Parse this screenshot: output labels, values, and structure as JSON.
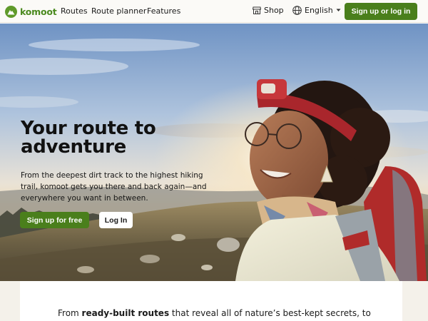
{
  "header": {
    "logo_text": "komoot",
    "nav": {
      "routes": "Routes",
      "route_planner": "Route planner",
      "features": "Features"
    },
    "shop_label": "Shop",
    "language_label": "English",
    "signup_login_label": "Sign up or log in"
  },
  "hero": {
    "title_line1": "Your route to",
    "title_line2": "adventure",
    "subtitle": "From the deepest dirt track to the highest hiking trail, komoot gets you there and back again—and everywhere you want in between.",
    "primary_cta": "Sign up for free",
    "secondary_cta": "Log In"
  },
  "intro": {
    "prefix": "From ",
    "bold": "ready-built routes",
    "suffix": " that reveal all of nature’s best-kept secrets, to"
  },
  "icons": {
    "logo": "komoot-logo-icon",
    "shop": "shop-icon",
    "language": "globe-icon",
    "chevron": "chevron-down-icon"
  },
  "colors": {
    "brand_green": "#4a7f1c",
    "logo_green": "#5f9a2a",
    "header_bg": "#fbfaf7"
  }
}
